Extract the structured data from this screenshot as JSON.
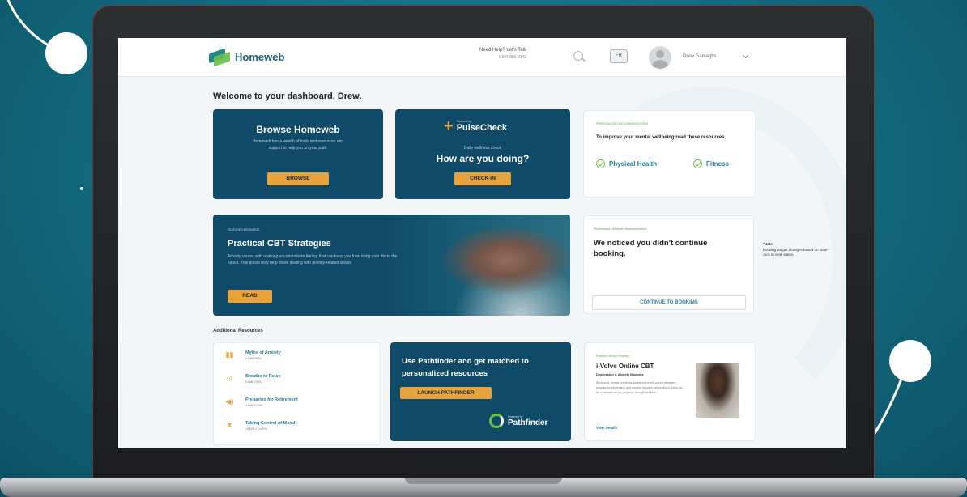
{
  "header": {
    "logo_text": "Homeweb",
    "help_title": "Need Help? Let's Talk",
    "help_phone": "1 844 880 9142",
    "lang_label": "FR",
    "user_name": "Drew Gamaghs"
  },
  "welcome": "Welcome to your dashboard, Drew.",
  "browse_card": {
    "title": "Browse Homeweb",
    "body": "Homeweb has a wealth of tools and resources and support to help you on your path.",
    "button": "BROWSE"
  },
  "pulse_card": {
    "logo_sub": "Powered by",
    "logo_name": "PulseCheck",
    "small": "Daily wellness check",
    "big": "How are you doing?",
    "button": "CHECK-IN"
  },
  "reco_card": {
    "tag": "PERSONALIZED RECOMMENDATIONS",
    "text": "To improve your mental wellbeing read these resources.",
    "items": [
      "Physical Health",
      "Fitness"
    ]
  },
  "cbt_card": {
    "tag": "FEATURED RESOURCE",
    "title": "Practical CBT Strategies",
    "body": "Anxiety comes with a strong uncomfortable feeling that can keep you from living your life to the fullest. This article may help those dealing with anxiety-related issues.",
    "button": "READ"
  },
  "booking_card": {
    "tag": "Personalized Pathfinder Recommendation",
    "text": "We noticed you didn't continue booking.",
    "button": "CONTINUE TO BOOKING"
  },
  "note": {
    "title": "*Note:",
    "body": "Booking widget changes based on state - click to view states"
  },
  "additional": {
    "title": "Additional Resources",
    "items": [
      {
        "name": "Myths of Anxiety",
        "meta": "6 MIN READ",
        "icon": "book-icon"
      },
      {
        "name": "Breathe to Relax",
        "meta": "5 MIN VIDEO",
        "icon": "play-icon"
      },
      {
        "name": "Preparing for Retirement",
        "meta": "4 MIN AUDIO",
        "icon": "audio-icon"
      },
      {
        "name": "Taking Control of Mood",
        "meta": "10 MIN COURSE",
        "icon": "course-icon"
      }
    ]
  },
  "pathfinder_card": {
    "title": "Use Pathfinder and get matched to personalized resources",
    "button": "LAUNCH PATHFINDER",
    "logo_sub": "Powered by",
    "logo_name": "Pathfinder"
  },
  "ivolve_card": {
    "tag": "Featured Service Program",
    "title": "i-Volve Online CBT",
    "sub": "Depression & Anxiety Modules",
    "body": "Structured, secure, evidence-based online self-paced treatment program for depression and anxiety. Includes personalized check-ins by a therapist as you progress through modules.",
    "link": "View Details"
  },
  "colors": {
    "background": "#136f82",
    "card_dark": "#0f4b68",
    "accent_orange": "#e8a33d",
    "accent_green": "#6cc04a",
    "link_teal": "#1f7d96"
  }
}
